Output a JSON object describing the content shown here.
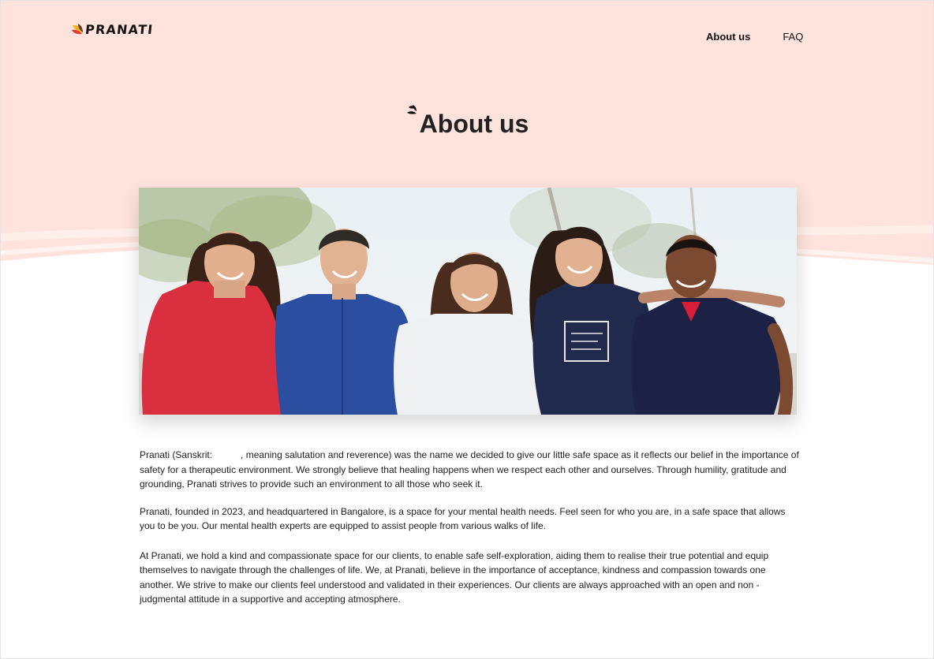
{
  "brand": {
    "name": "PRANATI"
  },
  "nav": {
    "items": [
      {
        "label": "About us",
        "active": true
      },
      {
        "label": "FAQ",
        "active": false
      }
    ]
  },
  "page": {
    "title": "About us"
  },
  "paragraphs": {
    "p1_before": "Pranati (Sanskrit:",
    "p1_after": ", meaning salutation and reverence) was the name we decided to give our little safe space as it reflects our belief in the importance of safety for a therapeutic environment. We strongly believe that healing happens when we respect each other and ourselves. Through humility, gratitude and grounding, Pranati strives to provide such an environment to all those who seek it.",
    "p2": "Pranati, founded in 2023, and headquartered in Bangalore, is a space for your mental health needs. Feel seen for who you are, in a safe space that allows you to be you. Our mental health experts are equipped to assist people from various walks of life.",
    "p3": "At Pranati, we hold a kind and compassionate space for our clients, to enable safe self-exploration, aiding them to realise their true potential and equip themselves to navigate through the challenges of life. We, at Pranati, believe in the importance of acceptance, kindness and compassion towards one another. We strive to make our clients feel understood and validated in their experiences. Our clients are always approached with an open and non - judgmental attitude in a supportive and accepting atmosphere."
  },
  "colors": {
    "hero_bg": "#fde3dc",
    "logo_petals": [
      "#e63b2e",
      "#f6b21a",
      "#6b3a2a"
    ],
    "shirt_colors": [
      "#d92f3e",
      "#2c4ea0",
      "#eef0f2",
      "#1f2a4d",
      "#1b2246"
    ]
  }
}
